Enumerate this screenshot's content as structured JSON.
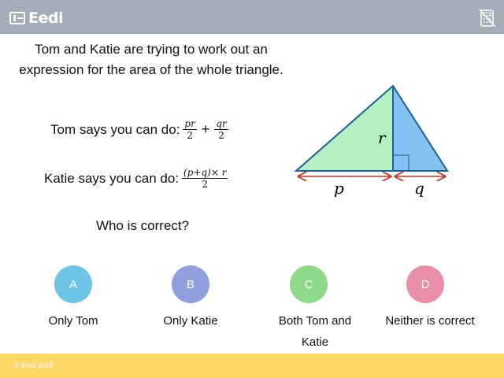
{
  "header": {
    "brand": "Eedi",
    "calculator_icon": "calculator-crossed-icon",
    "bar_color": "#a3adb8"
  },
  "question": {
    "text": "Tom and Katie are trying to work out an expression for the area of the whole triangle."
  },
  "tom": {
    "prefix": "Tom says you can do:",
    "frac1_num": "pr",
    "frac1_den": "2",
    "operator": "+",
    "frac2_num": "qr",
    "frac2_den": "2"
  },
  "katie": {
    "prefix": "Katie says you can do:",
    "frac_num": "(p+q)× r",
    "frac_den": "2"
  },
  "prompt": "Who is correct?",
  "diagram": {
    "label_r": "r",
    "label_p": "p",
    "label_q": "q",
    "left_fill": "#b3f0c4",
    "right_fill": "#84c2f3",
    "arrow_color": "#c0392b"
  },
  "options": [
    {
      "letter": "A",
      "text": "Only Tom",
      "color": "#6ec4e6"
    },
    {
      "letter": "B",
      "text": "Only Katie",
      "color": "#929fde"
    },
    {
      "letter": "C",
      "text": "Both Tom and Katie",
      "color": "#8fd98a"
    },
    {
      "letter": "D",
      "text": "Neither is correct",
      "color": "#e98ea8"
    }
  ],
  "footer": {
    "copyright": "© Eedi 2018",
    "bar_color": "#fdd766"
  }
}
